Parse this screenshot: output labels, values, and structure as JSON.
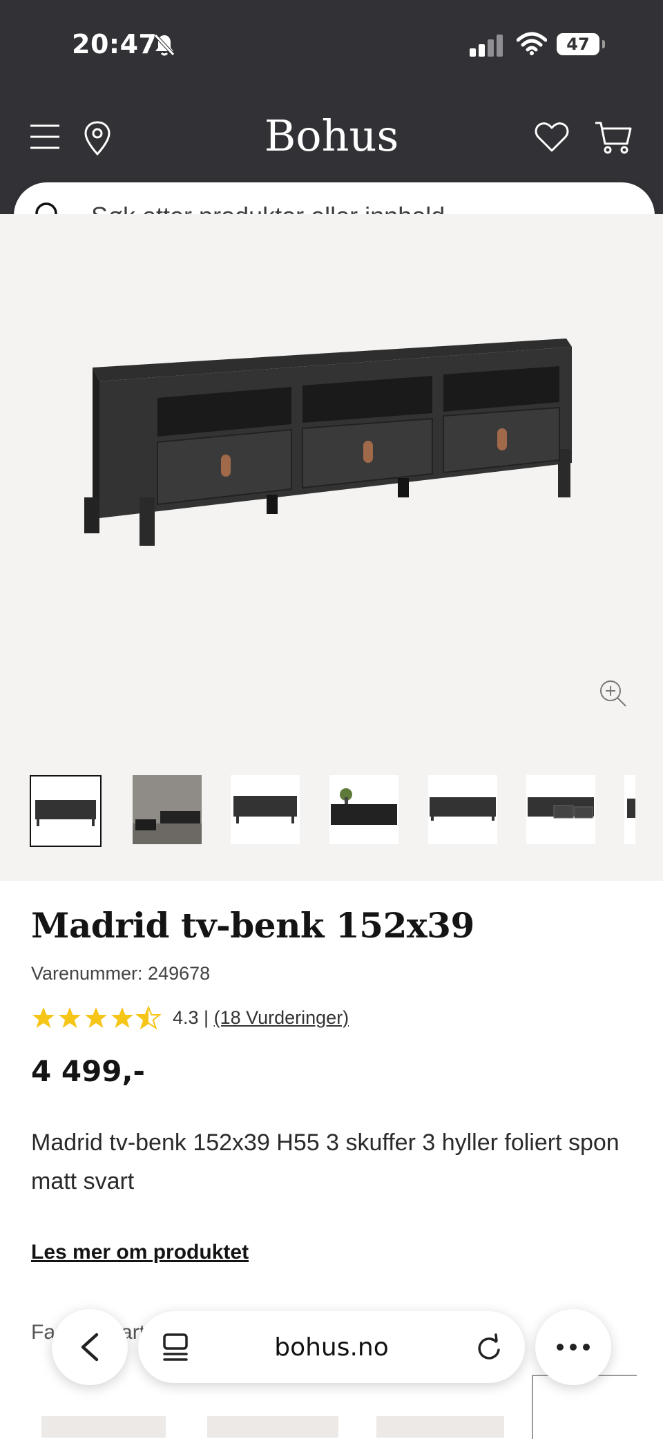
{
  "status_bar": {
    "time": "20:47",
    "battery": "47"
  },
  "header": {
    "logo": "Bohus"
  },
  "search": {
    "placeholder": "Søk etter produkter eller innhold ..."
  },
  "product": {
    "title": "Madrid tv-benk 152x39",
    "sku_label": "Varenummer: 249678",
    "rating_value": 4.3,
    "rating_text": "4.3 |",
    "reviews_text": "(18 Vurderinger)",
    "price": "4 499,-",
    "description": "Madrid tv-benk 152x39 H55 3 skuffer 3 hyller foliert spon matt svart",
    "more_link": "Les mer om produktet",
    "color_label": "Farge: Svart"
  },
  "gallery": {
    "thumbnail_count": 7,
    "active_index": 0
  },
  "browser": {
    "url": "bohus.no"
  },
  "icons": [
    "menu-icon",
    "location-pin-icon",
    "heart-icon",
    "cart-icon",
    "search-icon",
    "zoom-in-icon",
    "back-icon",
    "tabs-icon",
    "reload-icon",
    "more-icon"
  ],
  "colors": {
    "header_bg": "#323236",
    "star": "#f5c518",
    "gallery_bg": "#f4f3f1"
  }
}
